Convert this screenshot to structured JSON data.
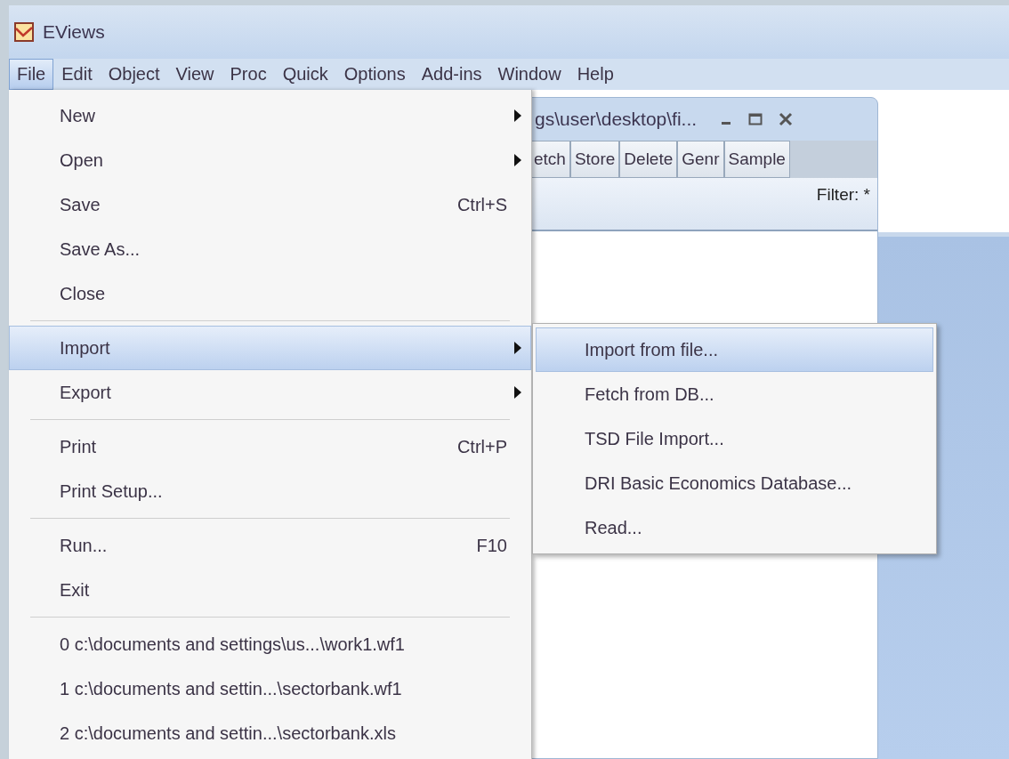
{
  "app": {
    "title": "EViews"
  },
  "menu_bar": [
    {
      "label": "File",
      "selected": true
    },
    {
      "label": "Edit",
      "selected": false
    },
    {
      "label": "Object",
      "selected": false
    },
    {
      "label": "View",
      "selected": false
    },
    {
      "label": "Proc",
      "selected": false
    },
    {
      "label": "Quick",
      "selected": false
    },
    {
      "label": "Options",
      "selected": false
    },
    {
      "label": "Add-ins",
      "selected": false
    },
    {
      "label": "Window",
      "selected": false
    },
    {
      "label": "Help",
      "selected": false
    }
  ],
  "child_window": {
    "title": "gs\\user\\desktop\\fi...",
    "toolbar": [
      "etch",
      "Store",
      "Delete",
      "Genr",
      "Sample"
    ],
    "filter": "Filter: *"
  },
  "file_menu": [
    {
      "kind": "item",
      "label": "New",
      "submenu": true,
      "selected": false
    },
    {
      "kind": "item",
      "label": "Open",
      "submenu": true,
      "selected": false
    },
    {
      "kind": "item",
      "label": "Save",
      "shortcut": "Ctrl+S",
      "submenu": false,
      "selected": false
    },
    {
      "kind": "item",
      "label": "Save As...",
      "submenu": false,
      "selected": false
    },
    {
      "kind": "item",
      "label": "Close",
      "submenu": false,
      "selected": false
    },
    {
      "kind": "separator"
    },
    {
      "kind": "item",
      "label": "Import",
      "submenu": true,
      "selected": true
    },
    {
      "kind": "item",
      "label": "Export",
      "submenu": true,
      "selected": false
    },
    {
      "kind": "separator"
    },
    {
      "kind": "item",
      "label": "Print",
      "shortcut": "Ctrl+P",
      "submenu": false,
      "selected": false
    },
    {
      "kind": "item",
      "label": "Print Setup...",
      "submenu": false,
      "selected": false
    },
    {
      "kind": "separator"
    },
    {
      "kind": "item",
      "label": "Run...",
      "shortcut": "F10",
      "submenu": false,
      "selected": false
    },
    {
      "kind": "item",
      "label": "Exit",
      "submenu": false,
      "selected": false
    },
    {
      "kind": "separator"
    },
    {
      "kind": "item",
      "label": "0 c:\\documents and settings\\us...\\work1.wf1",
      "submenu": false,
      "selected": false
    },
    {
      "kind": "item",
      "label": "1 c:\\documents and settin...\\sectorbank.wf1",
      "submenu": false,
      "selected": false
    },
    {
      "kind": "item",
      "label": "2 c:\\documents and settin...\\sectorbank.xls",
      "submenu": false,
      "selected": false
    }
  ],
  "import_submenu": [
    {
      "label": "Import from file...",
      "selected": true
    },
    {
      "label": "Fetch from DB...",
      "selected": false
    },
    {
      "label": "TSD File Import...",
      "selected": false
    },
    {
      "label": "DRI Basic Economics Database...",
      "selected": false
    },
    {
      "label": "Read...",
      "selected": false
    }
  ]
}
